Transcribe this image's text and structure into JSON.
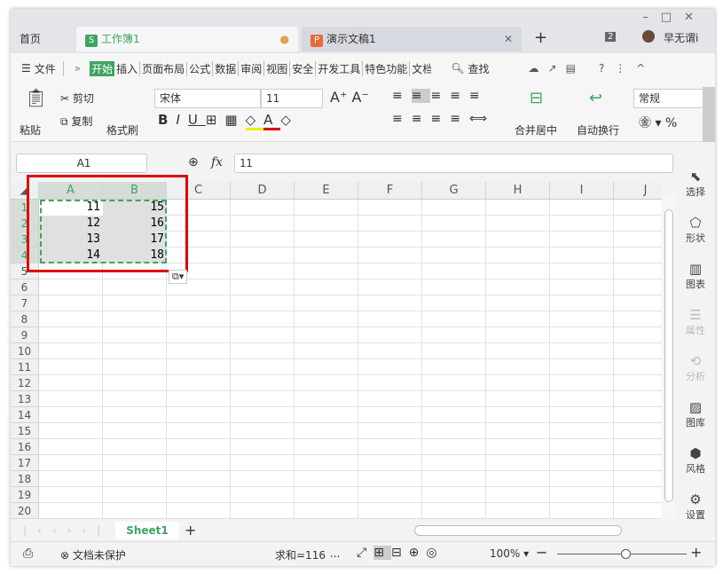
{
  "tabs": [
    {
      "label": "首页"
    },
    {
      "label": "工作簿1",
      "badge": "S",
      "color": "#3da55f"
    },
    {
      "label": "演示文稿1",
      "badge": "P",
      "color": "#e86a3a"
    }
  ],
  "tab_count": "2",
  "user": "早无谓i",
  "menu": {
    "file": "文件",
    "items": [
      "开始",
      "插入",
      "页面布局",
      "公式",
      "数据",
      "审阅",
      "视图",
      "安全",
      "开发工具",
      "特色功能",
      "文档"
    ],
    "search": "查找"
  },
  "toolbar": {
    "paste": "粘贴",
    "cut": "剪切",
    "copy": "复制",
    "format_painter": "格式刷",
    "font": "宋体",
    "size": "11",
    "merge": "合并居中",
    "wrap": "自动换行",
    "number_format": "常规",
    "percent": "%"
  },
  "formula": {
    "name_box": "A1",
    "fx": "fx",
    "value": "11"
  },
  "columns": [
    "A",
    "B",
    "C",
    "D",
    "E",
    "F",
    "G",
    "H",
    "I",
    "J"
  ],
  "rows": [
    "1",
    "2",
    "3",
    "4",
    "5",
    "6",
    "7",
    "8",
    "9",
    "10",
    "11",
    "12",
    "13",
    "14",
    "15",
    "16",
    "17",
    "18",
    "19",
    "20"
  ],
  "cells": [
    [
      "11",
      "15"
    ],
    [
      "12",
      "16"
    ],
    [
      "13",
      "17"
    ],
    [
      "14",
      "18"
    ]
  ],
  "right_panel": [
    "选择",
    "形状",
    "图表",
    "属性",
    "分析",
    "图库",
    "风格",
    "设置"
  ],
  "sheet_tab": "Sheet1",
  "status": {
    "protect": "文档未保护",
    "sum": "求和=116",
    "more": "...",
    "zoom": "100%"
  },
  "colors": {
    "accent": "#3da55f",
    "highlight": "#e00000"
  }
}
